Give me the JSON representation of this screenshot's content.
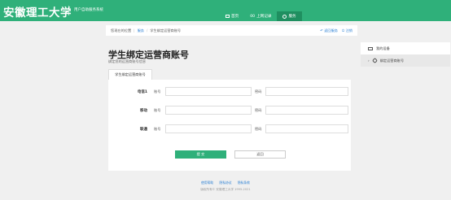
{
  "header": {
    "logo": "安徽理工大学",
    "subtitle": "用户自助服务系统",
    "nav": [
      {
        "label": "首页",
        "icon": "home-icon"
      },
      {
        "label": "上网记录",
        "icon": "hash-icon",
        "prefix": "00"
      },
      {
        "label": "服务",
        "icon": "gear-icon"
      }
    ]
  },
  "breadcrumb": {
    "prefix": "您现在的位置",
    "items": [
      "服务",
      "学生绑定运营商账号"
    ]
  },
  "top_links": {
    "back": "返回服务",
    "logout": "注销"
  },
  "sidebar": {
    "items": [
      "我的设备",
      "绑定运营商账号"
    ]
  },
  "page": {
    "title": "学生绑定运营商账号",
    "desc": "绑定您的运营商账号信息",
    "tab": "学生绑定运营商账号"
  },
  "form": {
    "account_label": "账号",
    "password_label": "密码",
    "rows": [
      {
        "carrier": "电信1"
      },
      {
        "carrier": "移动"
      },
      {
        "carrier": "联通"
      }
    ],
    "submit": "提 交",
    "back": "返回"
  },
  "footer": {
    "links": [
      "使用帮助",
      "隐私协议",
      "隐私条款"
    ],
    "copyright": "版权所有© 安徽理工大学 1995-2021"
  },
  "colors": {
    "brand": "#2fb07a",
    "link": "#2a7fd4"
  }
}
